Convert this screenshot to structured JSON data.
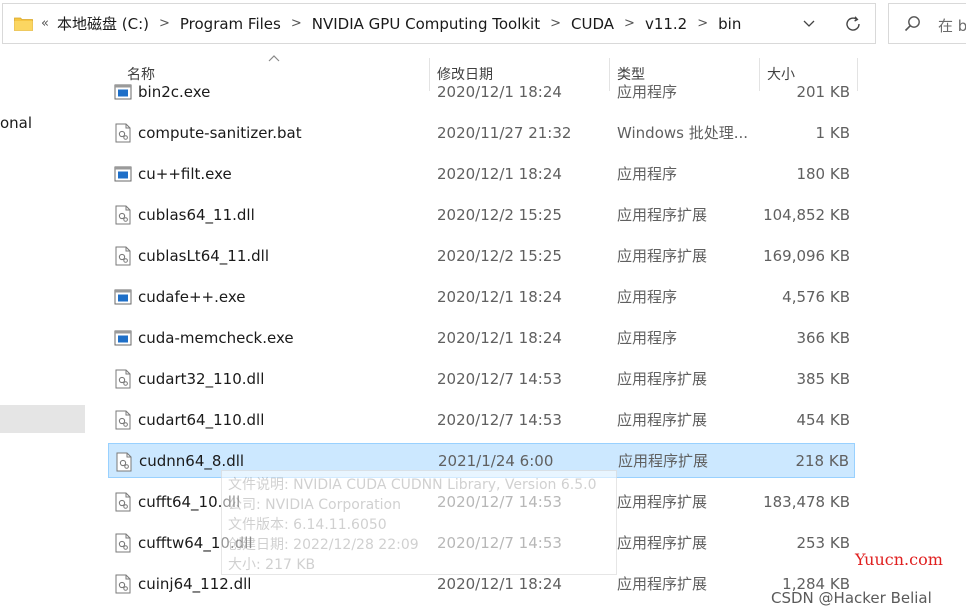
{
  "address_bar": {
    "prefix": "«",
    "crumbs": [
      "本地磁盘 (C:)",
      "Program Files",
      "NVIDIA GPU Computing Toolkit",
      "CUDA",
      "v11.2",
      "bin"
    ]
  },
  "search": {
    "placeholder": "在 b"
  },
  "left_nav": {
    "partial_label": "onal"
  },
  "columns": {
    "name": "名称",
    "date": "修改日期",
    "type": "类型",
    "size": "大小"
  },
  "files": [
    {
      "name": "bin2c.exe",
      "date": "2020/12/1 18:24",
      "type": "应用程序",
      "size": "201 KB",
      "icon": "exe-icon"
    },
    {
      "name": "compute-sanitizer.bat",
      "date": "2020/11/27 21:32",
      "type": "Windows 批处理...",
      "size": "1 KB",
      "icon": "bat-icon"
    },
    {
      "name": "cu++filt.exe",
      "date": "2020/12/1 18:24",
      "type": "应用程序",
      "size": "180 KB",
      "icon": "exe-icon"
    },
    {
      "name": "cublas64_11.dll",
      "date": "2020/12/2 15:25",
      "type": "应用程序扩展",
      "size": "104,852 KB",
      "icon": "dll-icon"
    },
    {
      "name": "cublasLt64_11.dll",
      "date": "2020/12/2 15:25",
      "type": "应用程序扩展",
      "size": "169,096 KB",
      "icon": "dll-icon"
    },
    {
      "name": "cudafe++.exe",
      "date": "2020/12/1 18:24",
      "type": "应用程序",
      "size": "4,576 KB",
      "icon": "exe-icon"
    },
    {
      "name": "cuda-memcheck.exe",
      "date": "2020/12/1 18:24",
      "type": "应用程序",
      "size": "366 KB",
      "icon": "exe-icon"
    },
    {
      "name": "cudart32_110.dll",
      "date": "2020/12/7 14:53",
      "type": "应用程序扩展",
      "size": "385 KB",
      "icon": "dll-icon"
    },
    {
      "name": "cudart64_110.dll",
      "date": "2020/12/7 14:53",
      "type": "应用程序扩展",
      "size": "454 KB",
      "icon": "dll-icon"
    },
    {
      "name": "cudnn64_8.dll",
      "date": "2021/1/24 6:00",
      "type": "应用程序扩展",
      "size": "218 KB",
      "icon": "dll-icon",
      "selected": true
    },
    {
      "name": "cufft64_10.dll",
      "date": "2020/12/7 14:53",
      "type": "应用程序扩展",
      "size": "183,478 KB",
      "icon": "dll-icon"
    },
    {
      "name": "cufftw64_10.dll",
      "date": "2020/12/7 14:53",
      "type": "应用程序扩展",
      "size": "253 KB",
      "icon": "dll-icon"
    },
    {
      "name": "cuinj64_112.dll",
      "date": "2020/12/1 18:24",
      "type": "应用程序扩展",
      "size": "1,284 KB",
      "icon": "dll-icon"
    }
  ],
  "tooltip": {
    "lines": [
      "文件说明: NVIDIA CUDA CUDNN Library, Version 6.5.0",
      "公司: NVIDIA Corporation",
      "文件版本: 6.14.11.6050",
      "创建日期: 2022/12/28 22:09",
      "大小: 217 KB"
    ]
  },
  "watermarks": {
    "site": "Yuucn.com",
    "author": "CSDN @Hacker Belial"
  },
  "colors": {
    "selection_bg": "#cce8ff",
    "selection_border": "#99d1ff",
    "exe_blue": "#1e6fc8",
    "folder_yellow": "#f5c542"
  }
}
